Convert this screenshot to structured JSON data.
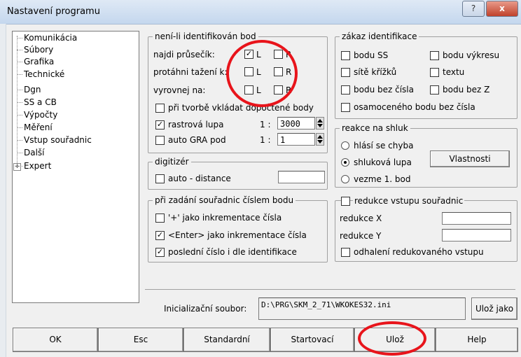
{
  "window": {
    "title": "Nastavení programu",
    "help_glyph": "?",
    "close_glyph": "x"
  },
  "tree": {
    "items": [
      {
        "label": "Komunikácia"
      },
      {
        "label": "Súbory"
      },
      {
        "label": "Grafika"
      },
      {
        "label": "Technické"
      },
      {
        "label": "Dgn"
      },
      {
        "label": "SS a CB"
      },
      {
        "label": "Výpočty"
      },
      {
        "label": "Měření"
      },
      {
        "label": "Vstup souřadnic"
      },
      {
        "label": "Další"
      },
      {
        "label": "Expert"
      }
    ],
    "expander": "+"
  },
  "ident": {
    "legend": "není-li identifikován bod",
    "rows": [
      {
        "label": "najdi průsečík:",
        "l_checked": true,
        "l_label": "L",
        "r_checked": false,
        "r_label": "R"
      },
      {
        "label": "protáhni tažení k:",
        "l_checked": false,
        "l_label": "L",
        "r_checked": false,
        "r_label": "R"
      },
      {
        "label": "vyrovnej na:",
        "l_checked": false,
        "l_label": "L",
        "r_checked": false,
        "r_label": "R"
      }
    ],
    "insert_computed": {
      "label": "při tvorbě vkládat dopočtené body",
      "checked": false
    },
    "raster": {
      "label": "rastrová lupa",
      "checked": true,
      "ratio": "1 :",
      "value": "3000"
    },
    "auto_gra": {
      "label": "auto GRA pod",
      "checked": false,
      "ratio": "1 :",
      "value": "1"
    }
  },
  "digitizer": {
    "legend": "digitizér",
    "auto_distance": {
      "label": "auto - distance",
      "checked": false,
      "value": ""
    }
  },
  "number_input": {
    "legend": "při zadání souřadnic číslem bodu",
    "items": [
      {
        "label": "'+' jako inkrementace čísla",
        "checked": false
      },
      {
        "label": "<Enter> jako inkrementace čísla",
        "checked": true
      },
      {
        "label": "poslední číslo i dle identifikace",
        "checked": true
      }
    ]
  },
  "zakaz": {
    "legend": "zákaz identifikace",
    "items": [
      {
        "label": "bodu SS",
        "checked": false
      },
      {
        "label": "bodu výkresu",
        "checked": false
      },
      {
        "label": "sítě křížků",
        "checked": false
      },
      {
        "label": "textu",
        "checked": false
      },
      {
        "label": "bodu bez čísla",
        "checked": false
      },
      {
        "label": "bodu bez Z",
        "checked": false
      },
      {
        "label": "osamoceného bodu bez čísla",
        "checked": false
      }
    ]
  },
  "cluster": {
    "legend": "reakce na shluk",
    "options": [
      {
        "label": "hlásí se chyba",
        "selected": false
      },
      {
        "label": "shluková lupa",
        "selected": true
      },
      {
        "label": "vezme 1. bod",
        "selected": false
      }
    ],
    "properties_button": "Vlastnosti"
  },
  "reduction": {
    "legend": "redukce vstupu souřadnic",
    "checked": false,
    "x_label": "redukce X",
    "x_value": "",
    "y_label": "redukce Y",
    "y_value": "",
    "reveal": {
      "label": "odhalení redukovaného vstupu",
      "checked": false
    }
  },
  "init_file": {
    "label": "Inicializační soubor:",
    "path": "D:\\PRG\\SKM_2_71\\WKOKES32.ini",
    "save_as": "Ulož jako"
  },
  "buttons": {
    "ok": "OK",
    "esc": "Esc",
    "standard": "Standardní",
    "startup": "Startovací",
    "save": "Ulož",
    "help": "Help"
  },
  "check_glyph": "✓"
}
